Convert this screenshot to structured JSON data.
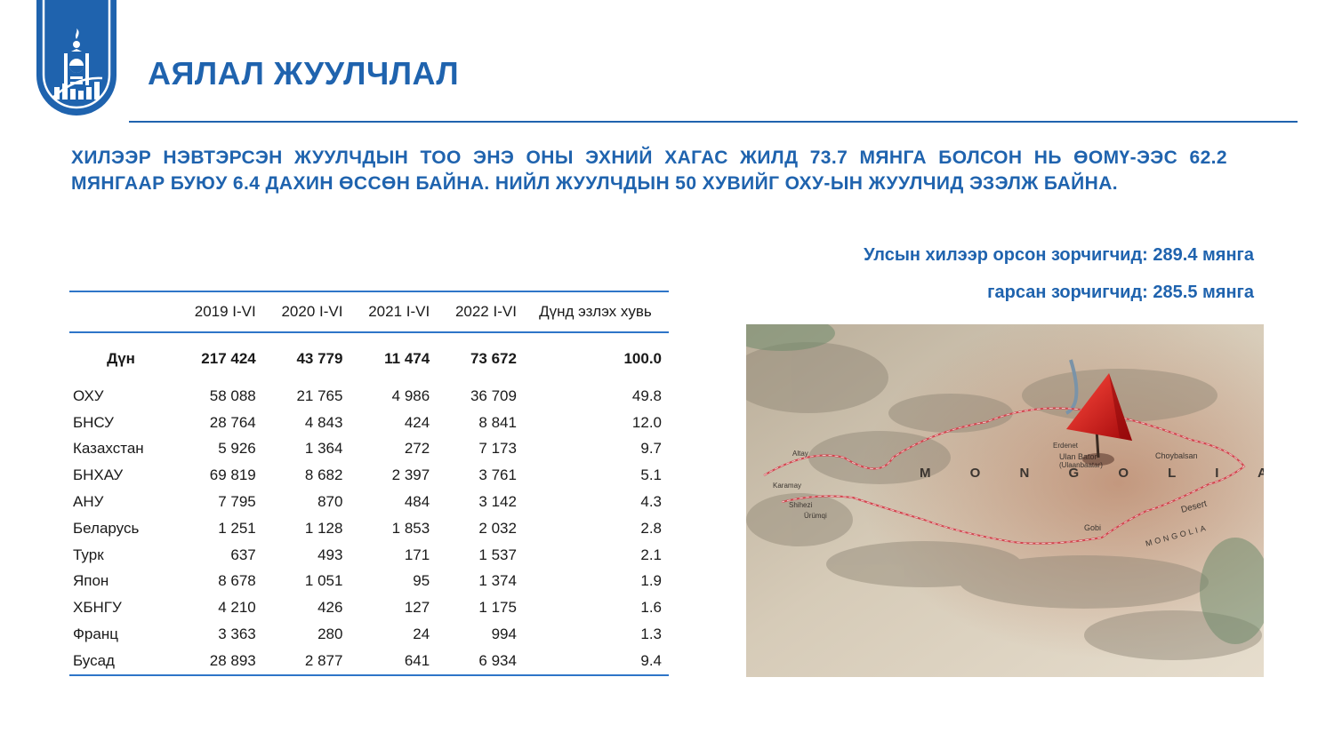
{
  "header": {
    "title": "АЯЛАЛ ЖУУЛЧЛАЛ"
  },
  "headline": "ХИЛЭЭР НЭВТЭРСЭН ЖУУЛЧДЫН ТОО ЭНЭ ОНЫ ЭХНИЙ ХАГАС ЖИЛД 73.7 МЯНГА БОЛСОН НЬ ӨОМҮ-ЭЭС 62.2 МЯНГААР БУЮУ 6.4 ДАХИН ӨССӨН БАЙНА. НИЙЛ ЖУУЛЧДЫН 50 ХУВИЙГ ОХУ-ЫН ЖУУЛЧИД ЭЗЭЛЖ БАЙНА.",
  "stats": {
    "entered": "Улсын хилээр орсон зорчигчид: 289.4 мянга",
    "exited": "гарсан зорчигчид: 285.5 мянга"
  },
  "table": {
    "headers": [
      "",
      "2019 I-VI",
      "2020 I-VI",
      "2021 I-VI",
      "2022 I-VI",
      "Дүнд эзлэх хувь"
    ],
    "total": [
      "Дүн",
      "217 424",
      "43 779",
      "11 474",
      "73 672",
      "100.0"
    ],
    "rows": [
      [
        "ОХУ",
        "58 088",
        "21 765",
        "4 986",
        "36 709",
        "49.8"
      ],
      [
        "БНСУ",
        "28 764",
        "4 843",
        "424",
        "8 841",
        "12.0"
      ],
      [
        "Казахстан",
        "5 926",
        "1 364",
        "272",
        "7 173",
        "9.7"
      ],
      [
        "БНХАУ",
        "69 819",
        "8 682",
        "2 397",
        "3 761",
        "5.1"
      ],
      [
        "АНУ",
        "7 795",
        "870",
        "484",
        "3 142",
        "4.3"
      ],
      [
        "Беларусь",
        "1 251",
        "1 128",
        "1 853",
        "2 032",
        "2.8"
      ],
      [
        "Турк",
        "637",
        "493",
        "171",
        "1 537",
        "2.1"
      ],
      [
        "Япон",
        "8 678",
        "1 051",
        "95",
        "1 374",
        "1.9"
      ],
      [
        "ХБНГУ",
        "4 210",
        "426",
        "127",
        "1 175",
        "1.6"
      ],
      [
        "Франц",
        "3 363",
        "280",
        "24",
        "994",
        "1.3"
      ],
      [
        "Бусад",
        "28 893",
        "2 877",
        "641",
        "6 934",
        "9.4"
      ]
    ]
  },
  "map": {
    "labels": [
      "M O N G O L I A",
      "Ulan Bator",
      "(Ulaanbaatar)",
      "Choybalsan",
      "Erdenet",
      "Gobi",
      "Desert",
      "MONGOLIA",
      "Karamay",
      "Shihezi",
      "Ürümqi",
      "Altay"
    ],
    "pin_color": "#d61f1f"
  },
  "colors": {
    "brand_blue": "#1f63ae",
    "rule_blue": "#2e75c8"
  }
}
